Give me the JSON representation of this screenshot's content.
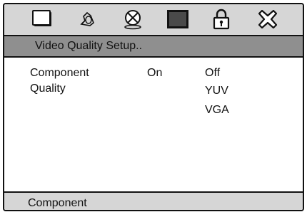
{
  "menu": {
    "icons": [
      "tv-icon",
      "audio-icon",
      "disc-icon",
      "video-icon",
      "lock-icon",
      "exit-icon"
    ],
    "title": "Video Quality Setup..",
    "settings": [
      {
        "label": "Component",
        "value": "On"
      },
      {
        "label": "Quality",
        "value": ""
      }
    ],
    "options": [
      "Off",
      "YUV",
      "VGA"
    ],
    "status": "Component"
  },
  "colors": {
    "bar": "#d6d6d6",
    "title_bar": "#8f8f8f",
    "border": "#111111"
  }
}
